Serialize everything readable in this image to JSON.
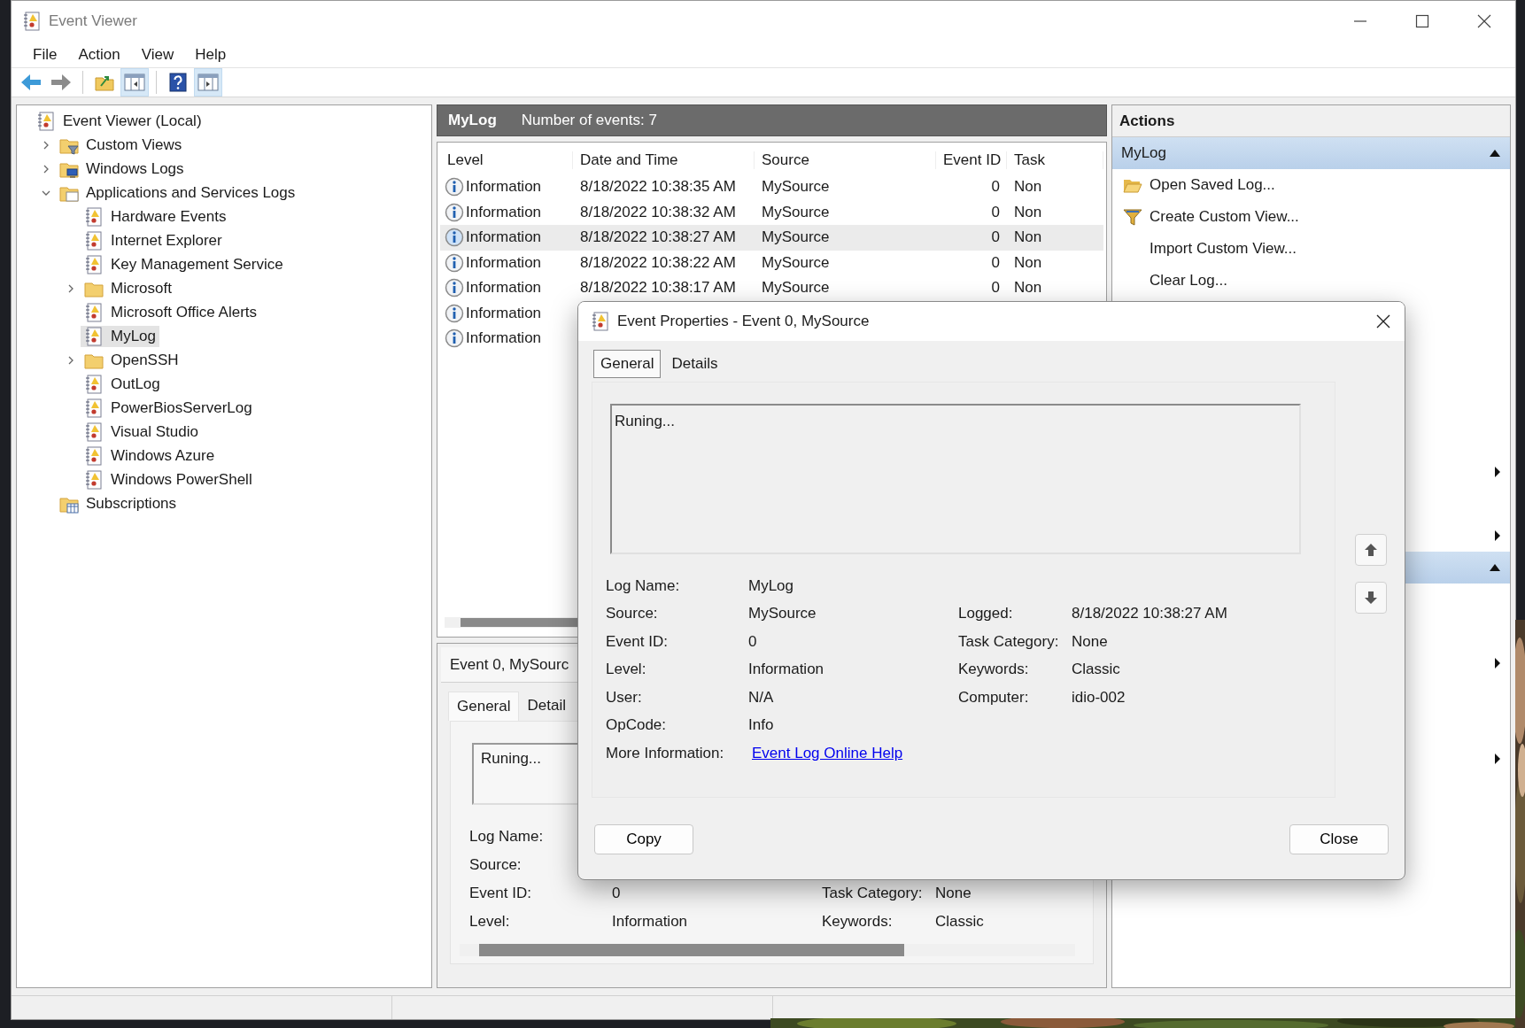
{
  "window": {
    "title": "Event Viewer"
  },
  "menu": [
    "File",
    "Action",
    "View",
    "Help"
  ],
  "toolbar": [
    {
      "kind": "back",
      "pressed": false
    },
    {
      "kind": "forward",
      "pressed": false
    },
    {
      "kind": "folder-up",
      "pressed": false
    },
    {
      "kind": "tree-toggle",
      "pressed": true
    },
    {
      "kind": "help",
      "pressed": false
    },
    {
      "kind": "pane-toggle",
      "pressed": true
    }
  ],
  "tree": [
    {
      "label": "Event Viewer (Local)",
      "kind": "log",
      "selected": false,
      "children": [
        {
          "label": "Custom Views",
          "kind": "filter-folder",
          "expanded": false,
          "selected": false
        },
        {
          "label": "Windows Logs",
          "kind": "computer-folder",
          "expanded": false,
          "selected": false
        },
        {
          "label": "Applications and Services Logs",
          "kind": "page-folder",
          "expanded": true,
          "selected": false,
          "children": [
            {
              "label": "Hardware Events",
              "kind": "log",
              "selected": false
            },
            {
              "label": "Internet Explorer",
              "kind": "log",
              "selected": false
            },
            {
              "label": "Key Management Service",
              "kind": "log",
              "selected": false
            },
            {
              "label": "Microsoft",
              "kind": "folder",
              "expanded": false,
              "selected": false
            },
            {
              "label": "Microsoft Office Alerts",
              "kind": "log",
              "selected": false
            },
            {
              "label": "MyLog",
              "kind": "log",
              "selected": true
            },
            {
              "label": "OpenSSH",
              "kind": "folder",
              "expanded": false,
              "selected": false
            },
            {
              "label": "OutLog",
              "kind": "log",
              "selected": false
            },
            {
              "label": "PowerBiosServerLog",
              "kind": "log",
              "selected": false
            },
            {
              "label": "Visual Studio",
              "kind": "log",
              "selected": false
            },
            {
              "label": "Windows Azure",
              "kind": "log",
              "selected": false
            },
            {
              "label": "Windows PowerShell",
              "kind": "log",
              "selected": false
            }
          ]
        },
        {
          "label": "Subscriptions",
          "kind": "calendar-folder",
          "selected": false
        }
      ]
    }
  ],
  "log_view": {
    "name": "MyLog",
    "count": "Number of events: 7",
    "columns": [
      "Level",
      "Date and Time",
      "Source",
      "Event ID",
      "Task"
    ],
    "rows": [
      {
        "level": "Information",
        "date": "8/18/2022 10:38:35 AM",
        "source": "MySource",
        "event_id": "0",
        "task": "Non",
        "selected": false
      },
      {
        "level": "Information",
        "date": "8/18/2022 10:38:32 AM",
        "source": "MySource",
        "event_id": "0",
        "task": "Non",
        "selected": false
      },
      {
        "level": "Information",
        "date": "8/18/2022 10:38:27 AM",
        "source": "MySource",
        "event_id": "0",
        "task": "Non",
        "selected": true
      },
      {
        "level": "Information",
        "date": "8/18/2022 10:38:22 AM",
        "source": "MySource",
        "event_id": "0",
        "task": "Non",
        "selected": false
      },
      {
        "level": "Information",
        "date": "8/18/2022 10:38:17 AM",
        "source": "MySource",
        "event_id": "0",
        "task": "Non",
        "selected": false
      },
      {
        "level": "Information",
        "selected": false
      },
      {
        "level": "Information",
        "selected": false
      }
    ]
  },
  "preview": {
    "title": "Event 0, MySourc",
    "tabs": [
      {
        "label": "General",
        "selected": true
      },
      {
        "label": "Detail",
        "selected": false
      }
    ],
    "message": "Runing...",
    "fields": [
      {
        "label": "Log Name:"
      },
      {
        "label": "Source:"
      },
      {
        "label": "Event ID:",
        "value": "0"
      },
      {
        "label": "Level:",
        "value": "Information"
      }
    ],
    "right_fields": [
      {
        "label": "Task Category:",
        "value": "None"
      },
      {
        "label": "Keywords:",
        "value": "Classic"
      }
    ]
  },
  "actions": {
    "title": "Actions",
    "sections": [
      {
        "title": "MyLog",
        "expanded": true,
        "items": [
          {
            "label": "Open Saved Log...",
            "kind": "open-folder",
            "submenu": false
          },
          {
            "label": "Create Custom View...",
            "kind": "filter",
            "submenu": false
          },
          {
            "label": "Import Custom View...",
            "submenu": false
          },
          {
            "label": "Clear Log...",
            "submenu": false
          },
          {
            "submenu": false
          },
          {
            "submenu": false
          },
          {
            "submenu": false
          },
          {
            "submenu": false
          },
          {
            "submenu": false
          },
          {
            "submenu": true
          },
          {
            "submenu": false
          },
          {
            "submenu": true
          }
        ]
      },
      {
        "expanded": true,
        "items": [
          {
            "submenu": false
          },
          {
            "submenu": false
          },
          {
            "submenu": true
          },
          {
            "submenu": false
          },
          {
            "submenu": false
          },
          {
            "submenu": true
          }
        ]
      }
    ]
  },
  "dialog": {
    "title": "Event Properties - Event 0, MySource",
    "tabs": [
      {
        "label": "General",
        "selected": true
      },
      {
        "label": "Details",
        "selected": false
      }
    ],
    "message": "Runing...",
    "fields": [
      {
        "label": "Log Name:",
        "value": "MyLog"
      },
      {
        "label": "Source:",
        "value": "MySource"
      },
      {
        "label": "Event ID:",
        "value": "0"
      },
      {
        "label": "Level:",
        "value": "Information"
      },
      {
        "label": "User:",
        "value": "N/A"
      },
      {
        "label": "OpCode:",
        "value": "Info"
      }
    ],
    "right_fields": [
      {
        "label": "Logged:",
        "value": "8/18/2022 10:38:27 AM"
      },
      {
        "label": "Task Category:",
        "value": "None"
      },
      {
        "label": "Keywords:",
        "value": "Classic"
      },
      {
        "label": "Computer:",
        "value": "idio-002"
      }
    ],
    "more_info": {
      "label": "More Information:",
      "link": "Event Log Online Help"
    },
    "buttons": [
      "Copy",
      "Close"
    ]
  }
}
